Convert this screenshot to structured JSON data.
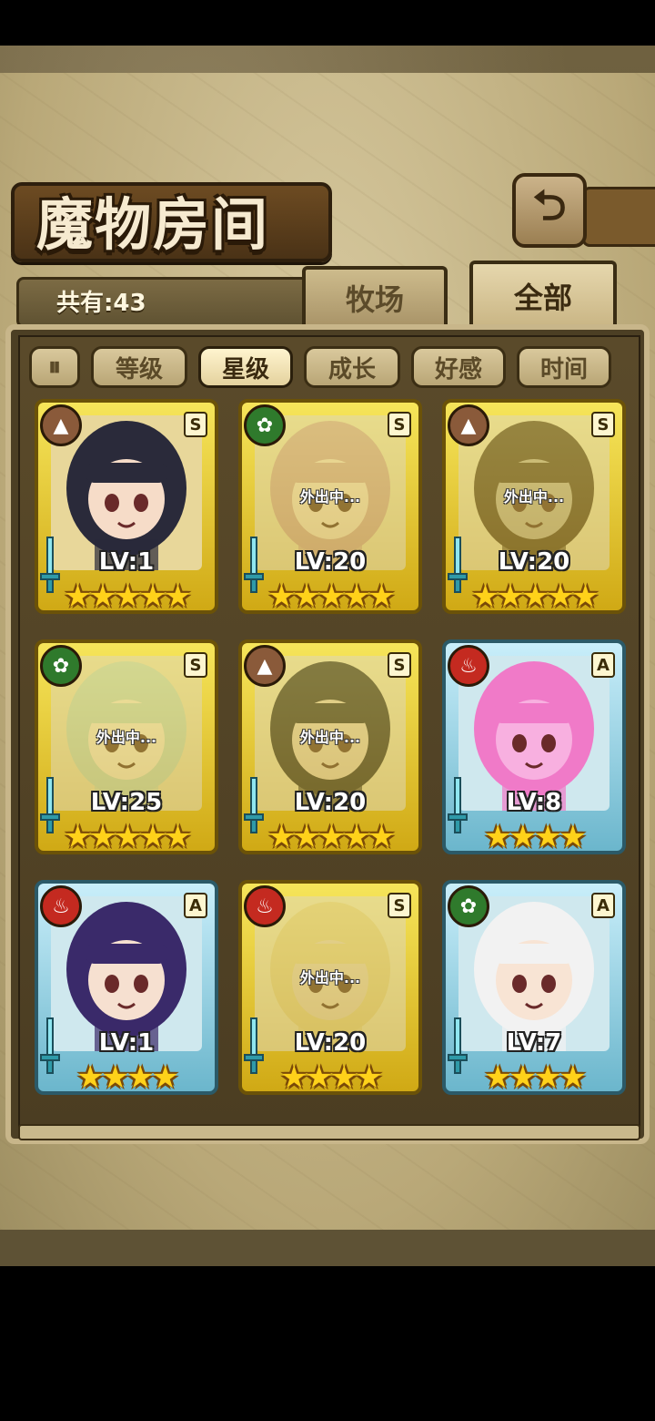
{
  "header": {
    "title": "魔物房间",
    "back_icon": "return-arrow-icon"
  },
  "count": {
    "label": "共有:43"
  },
  "tabs": [
    {
      "label": "牧场",
      "active": false
    },
    {
      "label": "全部",
      "active": true
    }
  ],
  "filters": {
    "toggle_icon": "pause-bars-icon",
    "items": [
      {
        "label": "等级",
        "active": false
      },
      {
        "label": "星级",
        "active": true
      },
      {
        "label": "成长",
        "active": false
      },
      {
        "label": "好感",
        "active": false
      },
      {
        "label": "时间",
        "active": false
      }
    ]
  },
  "monsters": [
    {
      "element": "earth",
      "rank": "S",
      "level": "LV:1",
      "stars": "★★★★★",
      "status": "",
      "frame": "gold",
      "hair": "#2a2a3a",
      "skin": "#f6dcc8"
    },
    {
      "element": "leaf",
      "rank": "S",
      "level": "LV:20",
      "stars": "★★★★★",
      "status": "外出中...",
      "frame": "gold",
      "hair": "#e49a9a",
      "skin": "#f3d4c0"
    },
    {
      "element": "earth",
      "rank": "S",
      "level": "LV:20",
      "stars": "★★★★★",
      "status": "外出中...",
      "frame": "gold",
      "hair": "#5a3a24",
      "skin": "#b8a890"
    },
    {
      "element": "leaf",
      "rank": "S",
      "level": "LV:25",
      "stars": "★★★★★",
      "status": "外出中...",
      "frame": "gold",
      "hair": "#a8d8b8",
      "skin": "#f2e0c8"
    },
    {
      "element": "earth",
      "rank": "S",
      "level": "LV:20",
      "stars": "★★★★★",
      "status": "外出中...",
      "frame": "gold",
      "hair": "#2a2a3a",
      "skin": "#e6c8a8"
    },
    {
      "element": "fire",
      "rank": "A",
      "level": "LV:8",
      "stars": "★★★★",
      "status": "",
      "frame": "blue",
      "hair": "#f07ac8",
      "skin": "#f8b0e0"
    },
    {
      "element": "fire",
      "rank": "A",
      "level": "LV:1",
      "stars": "★★★★",
      "status": "",
      "frame": "blue",
      "hair": "#3a2a6a",
      "skin": "#f6e0d0"
    },
    {
      "element": "fire",
      "rank": "S",
      "level": "LV:20",
      "stars": "★★★★",
      "status": "外出中...",
      "frame": "gold",
      "hair": "#e8c860",
      "skin": "#e8c8a8"
    },
    {
      "element": "leaf",
      "rank": "A",
      "level": "LV:7",
      "stars": "★★★★",
      "status": "",
      "frame": "blue",
      "hair": "#f2f2f2",
      "skin": "#f8e4d4"
    }
  ]
}
